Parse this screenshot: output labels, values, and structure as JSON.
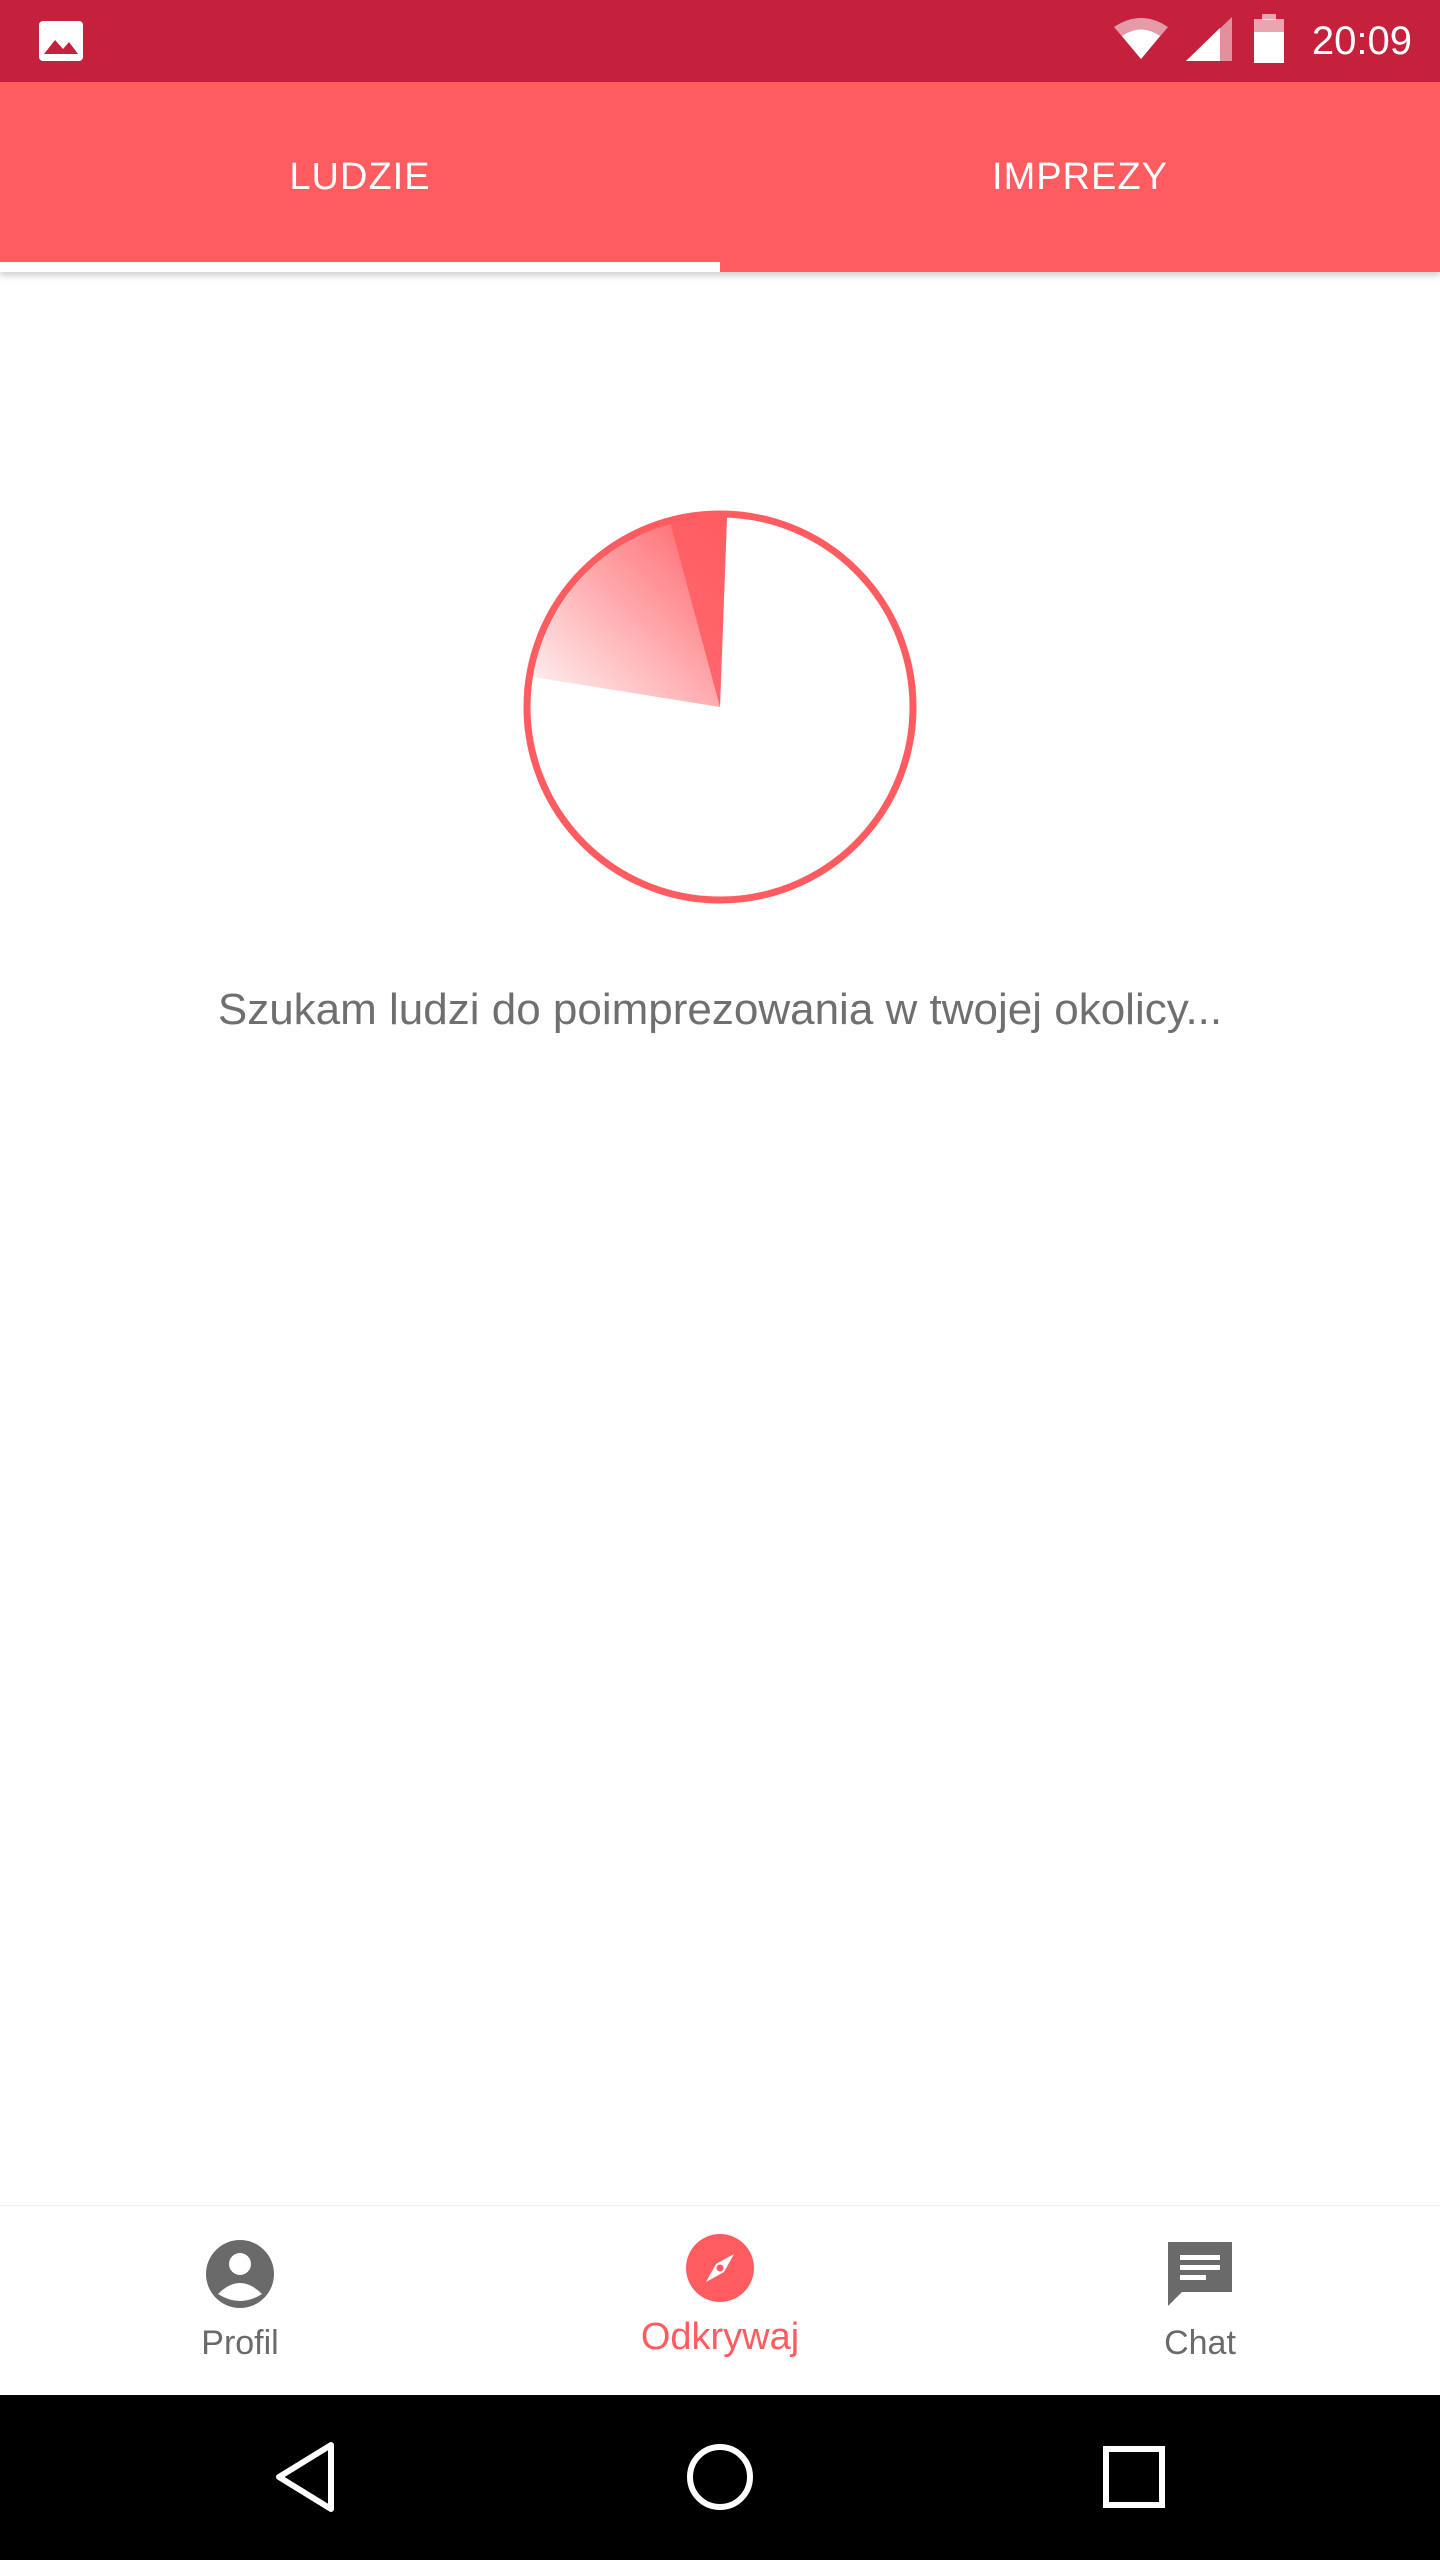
{
  "status_bar": {
    "time": "20:09",
    "icons": [
      "gallery-notification-icon",
      "wifi-icon",
      "cellular-signal-icon",
      "battery-icon"
    ]
  },
  "tabs": [
    {
      "label": "LUDZIE",
      "active": true
    },
    {
      "label": "IMPREZY",
      "active": false
    }
  ],
  "main": {
    "searching_text": "Szukam ludzi do poimprezowania w twojej okolicy..."
  },
  "bottom_nav": [
    {
      "label": "Profil",
      "icon": "account-circle-icon",
      "active": false
    },
    {
      "label": "Odkrywaj",
      "icon": "compass-icon",
      "active": true
    },
    {
      "label": "Chat",
      "icon": "chat-icon",
      "active": false
    }
  ],
  "system_nav": [
    "back-icon",
    "home-icon",
    "recents-icon"
  ],
  "colors": {
    "status_bar": "#c5213c",
    "accent": "#ff5c62",
    "text_muted": "#6f6f6f"
  }
}
